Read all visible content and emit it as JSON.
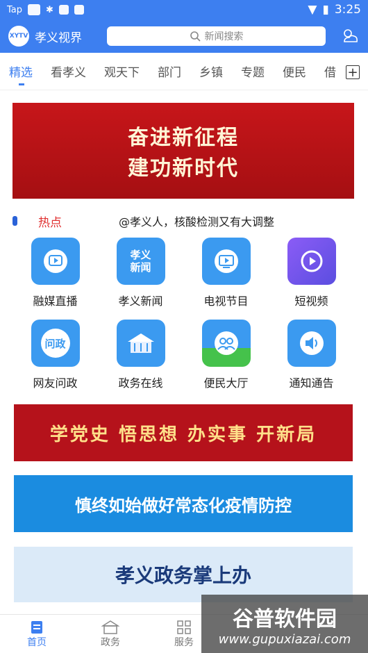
{
  "status": {
    "carrier": "Tap",
    "time": "3:25"
  },
  "header": {
    "app_title": "孝义视界",
    "logo_text": "XYTV",
    "search_placeholder": "新闻搜索"
  },
  "tabs": [
    "精选",
    "看孝义",
    "观天下",
    "部门",
    "乡镇",
    "专题",
    "便民",
    "借"
  ],
  "banner1": {
    "line1": "奋进新征程",
    "line2": "建功新时代"
  },
  "hot": {
    "label": "热点",
    "text": "@孝义人，核酸检测又有大调整"
  },
  "grid": [
    {
      "label": "融媒直播",
      "icon": "live-icon",
      "icon_text": ""
    },
    {
      "label": "孝义新闻",
      "icon": "news-icon",
      "icon_text": "孝义新闻"
    },
    {
      "label": "电视节目",
      "icon": "tv-icon",
      "icon_text": ""
    },
    {
      "label": "短视频",
      "icon": "short-video-icon",
      "icon_text": ""
    },
    {
      "label": "网友问政",
      "icon": "inquiry-icon",
      "icon_text": "问政"
    },
    {
      "label": "政务在线",
      "icon": "gov-building-icon",
      "icon_text": ""
    },
    {
      "label": "便民大厅",
      "icon": "people-icon",
      "icon_text": ""
    },
    {
      "label": "通知通告",
      "icon": "speaker-icon",
      "icon_text": ""
    }
  ],
  "banner2": {
    "text": "学党史 悟思想 办实事 开新局"
  },
  "banner3": {
    "text": "慎终如始做好常态化疫情防控"
  },
  "banner4": {
    "text": "孝义政务掌上办"
  },
  "bottom_nav": [
    "首页",
    "政务",
    "服务"
  ],
  "watermark": {
    "line1": "谷普软件园",
    "line2": "www.gupuxiazai.com"
  },
  "colors": {
    "primary": "#3d7ff0",
    "hot_red": "#e03030",
    "banner_red": "#c7161a"
  }
}
